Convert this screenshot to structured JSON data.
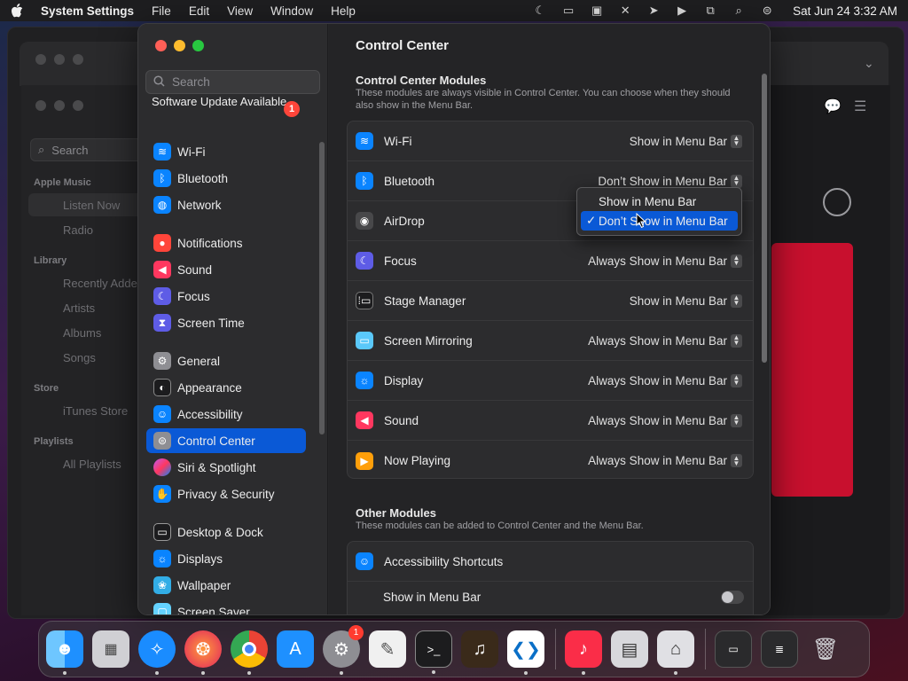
{
  "menubar": {
    "app_name": "System Settings",
    "menus": [
      "File",
      "Edit",
      "View",
      "Window",
      "Help"
    ],
    "clock": "Sat Jun 24  3:32 AM"
  },
  "music": {
    "search_placeholder": "Search",
    "sections": {
      "apple_music": "Apple Music",
      "library": "Library",
      "store": "Store",
      "playlists": "Playlists"
    },
    "items": {
      "listen_now": "Listen Now",
      "radio": "Radio",
      "recently_added": "Recently Added",
      "artists": "Artists",
      "albums": "Albums",
      "songs": "Songs",
      "itunes_store": "iTunes Store",
      "all_playlists": "All Playlists"
    }
  },
  "sidebar": {
    "search_placeholder": "Search",
    "software_update": "Software Update Available",
    "software_update_badge": "1",
    "items": [
      {
        "label": "Wi-Fi",
        "icon": "wifi-icon",
        "color": "#0a84ff"
      },
      {
        "label": "Bluetooth",
        "icon": "bluetooth-icon",
        "color": "#0a84ff"
      },
      {
        "label": "Network",
        "icon": "globe-icon",
        "color": "#0a84ff"
      },
      {
        "label": "Notifications",
        "icon": "bell-icon",
        "color": "#ff453a"
      },
      {
        "label": "Sound",
        "icon": "speaker-icon",
        "color": "#ff375f"
      },
      {
        "label": "Focus",
        "icon": "moon-icon",
        "color": "#5e5ce6"
      },
      {
        "label": "Screen Time",
        "icon": "hourglass-icon",
        "color": "#5e5ce6"
      },
      {
        "label": "General",
        "icon": "gear-icon",
        "color": "#8e8e93"
      },
      {
        "label": "Appearance",
        "icon": "appearance-icon",
        "color": "#1c1c1e"
      },
      {
        "label": "Accessibility",
        "icon": "accessibility-icon",
        "color": "#0a84ff"
      },
      {
        "label": "Control Center",
        "icon": "control-center-icon",
        "color": "#8e8e93"
      },
      {
        "label": "Siri & Spotlight",
        "icon": "siri-icon",
        "color": "#bf5af2"
      },
      {
        "label": "Privacy & Security",
        "icon": "hand-icon",
        "color": "#0a84ff"
      },
      {
        "label": "Desktop & Dock",
        "icon": "dock-icon",
        "color": "#1c1c1e"
      },
      {
        "label": "Displays",
        "icon": "sun-icon",
        "color": "#0a84ff"
      },
      {
        "label": "Wallpaper",
        "icon": "wallpaper-icon",
        "color": "#32ade6"
      },
      {
        "label": "Screen Saver",
        "icon": "screensaver-icon",
        "color": "#64d2ff"
      }
    ]
  },
  "content": {
    "title": "Control Center",
    "modules_title": "Control Center Modules",
    "modules_desc": "These modules are always visible in Control Center. You can choose when they should also show in the Menu Bar.",
    "modules": [
      {
        "label": "Wi-Fi",
        "value": "Show in Menu Bar",
        "icon": "wifi-icon",
        "color": "#0a84ff"
      },
      {
        "label": "Bluetooth",
        "value": "Don’t Show in Menu Bar",
        "icon": "bluetooth-icon",
        "color": "#0a84ff"
      },
      {
        "label": "AirDrop",
        "value": "",
        "icon": "airdrop-icon",
        "color": "#48484a"
      },
      {
        "label": "Focus",
        "value": "Always Show in Menu Bar",
        "icon": "moon-icon",
        "color": "#5e5ce6"
      },
      {
        "label": "Stage Manager",
        "value": "Show in Menu Bar",
        "icon": "stage-manager-icon",
        "color": "#1c1c1e"
      },
      {
        "label": "Screen Mirroring",
        "value": "Always Show in Menu Bar",
        "icon": "screen-mirroring-icon",
        "color": "#5ac8fa"
      },
      {
        "label": "Display",
        "value": "Always Show in Menu Bar",
        "icon": "sun-icon",
        "color": "#0a84ff"
      },
      {
        "label": "Sound",
        "value": "Always Show in Menu Bar",
        "icon": "speaker-icon",
        "color": "#ff375f"
      },
      {
        "label": "Now Playing",
        "value": "Always Show in Menu Bar",
        "icon": "play-icon",
        "color": "#ff9f0a"
      }
    ],
    "other_title": "Other Modules",
    "other_desc": "These modules can be added to Control Center and the Menu Bar.",
    "accessibility_shortcuts": "Accessibility Shortcuts",
    "show_in_menu_bar": "Show in Menu Bar",
    "show_in_menu_bar_toggle": false
  },
  "popup": {
    "options": [
      "Show in Menu Bar",
      "Don’t Show in Menu Bar"
    ],
    "selected": "Don’t Show in Menu Bar",
    "check": "✓"
  },
  "dock": {
    "apps": [
      {
        "name": "Finder",
        "icon": "finder-icon",
        "color": "#1e90ff"
      },
      {
        "name": "Launchpad",
        "icon": "launchpad-icon",
        "color": "#d0d0d4"
      },
      {
        "name": "Safari",
        "icon": "safari-icon",
        "color": "#1a8cff"
      },
      {
        "name": "Firefox",
        "icon": "firefox-icon",
        "color": "#ff7139"
      },
      {
        "name": "Chrome",
        "icon": "chrome-icon",
        "color": "#ffffff"
      },
      {
        "name": "App Store",
        "icon": "app-store-icon",
        "color": "#1e90ff"
      },
      {
        "name": "System Settings",
        "icon": "settings-icon",
        "color": "#8e8e93",
        "badge": "1"
      },
      {
        "name": "TextEdit",
        "icon": "textedit-icon",
        "color": "#f0f0f0"
      },
      {
        "name": "Terminal",
        "icon": "terminal-icon",
        "color": "#1c1c1e"
      },
      {
        "name": "Instruments",
        "icon": "guitar-icon",
        "color": "#3a2a1a"
      },
      {
        "name": "Visual Studio Code",
        "icon": "vscode-icon",
        "color": "#ffffff"
      },
      {
        "name": "Music",
        "icon": "music-icon",
        "color": "#fa2d48"
      },
      {
        "name": "Preview",
        "icon": "preview-icon",
        "color": "#d8d8dc"
      },
      {
        "name": "System Information",
        "icon": "system-info-icon",
        "color": "#e0e0e4"
      }
    ]
  }
}
